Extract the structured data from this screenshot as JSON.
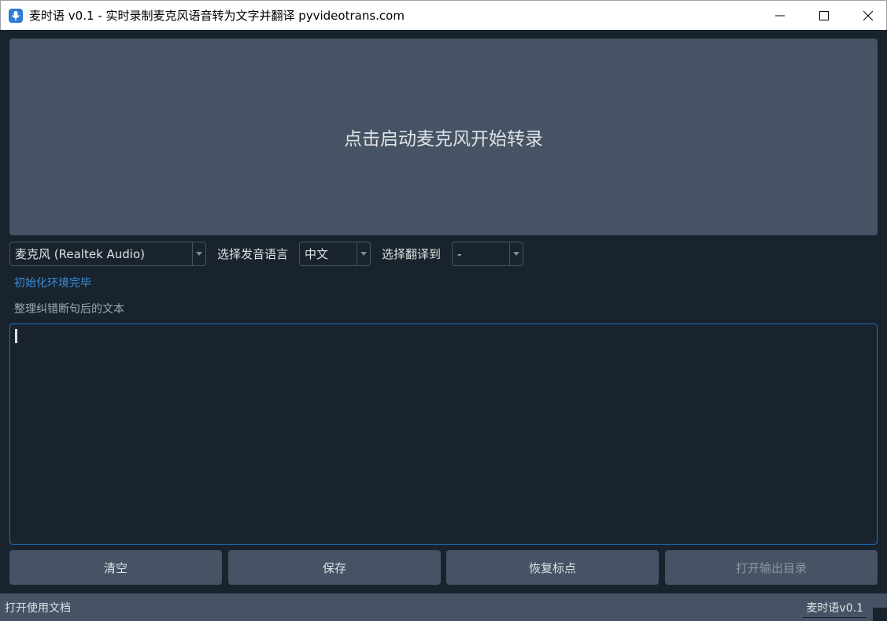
{
  "window": {
    "title": "麦时语 v0.1 - 实时录制麦克风语音转为文字并翻译   pyvideotrans.com",
    "icon": "microphone-icon",
    "accent": "#2f7bd8"
  },
  "mic_panel": {
    "label": "点击启动麦克风开始转录"
  },
  "controls": {
    "device_value": "麦克风 (Realtek Audio)",
    "source_lang_label": "选择发音语言",
    "source_lang_value": "中文",
    "target_lang_label": "选择翻译到",
    "target_lang_value": "-"
  },
  "status": {
    "init_text": "初始化环境完毕",
    "init_color": "#3a8fd6"
  },
  "editor": {
    "label": "整理纠错断句后的文本",
    "value": ""
  },
  "buttons": {
    "clear": "清空",
    "save": "保存",
    "restore_punct": "恢复标点",
    "open_output": "打开输出目录"
  },
  "statusbar": {
    "doc_link": "打开使用文档",
    "version": "麦时语v0.1"
  },
  "colors": {
    "background": "#19232d",
    "panel": "#455364",
    "focus_border": "#1a72bb"
  }
}
